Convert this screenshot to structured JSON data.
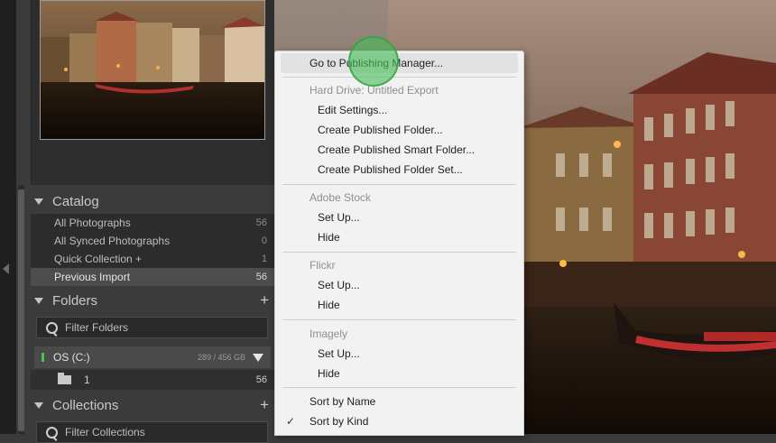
{
  "catalog": {
    "title": "Catalog",
    "items": [
      {
        "label": "All Photographs",
        "count": "56"
      },
      {
        "label": "All Synced Photographs",
        "count": "0"
      },
      {
        "label": "Quick Collection +",
        "count": "1"
      },
      {
        "label": "Previous Import",
        "count": "56"
      }
    ]
  },
  "folders": {
    "title": "Folders",
    "filter_placeholder": "Filter Folders",
    "volume": {
      "name": "OS (C:)",
      "size": "289 / 456 GB"
    },
    "items": [
      {
        "label": "1",
        "count": "56"
      }
    ]
  },
  "collections": {
    "title": "Collections",
    "filter_placeholder": "Filter Collections"
  },
  "menu": {
    "go_to_publishing_manager": "Go to Publishing Manager...",
    "hard_drive": {
      "header": "Hard Drive: Untitled Export",
      "items": [
        "Edit Settings...",
        "Create Published Folder...",
        "Create Published Smart Folder...",
        "Create Published Folder Set..."
      ]
    },
    "adobe_stock": {
      "header": "Adobe Stock",
      "items": [
        "Set Up...",
        "Hide"
      ]
    },
    "flickr": {
      "header": "Flickr",
      "items": [
        "Set Up...",
        "Hide"
      ]
    },
    "imagely": {
      "header": "Imagely",
      "items": [
        "Set Up...",
        "Hide"
      ]
    },
    "sort": [
      "Sort by Name",
      "Sort by Kind"
    ],
    "checked_item": "Sort by Kind"
  },
  "colors": {
    "panel_bg": "#3b3b3b",
    "menu_bg": "#f2f2f2",
    "selected_row": "#4d4d4d",
    "click_indicator": "#48be5a",
    "volume_led": "#4fbf4f"
  }
}
